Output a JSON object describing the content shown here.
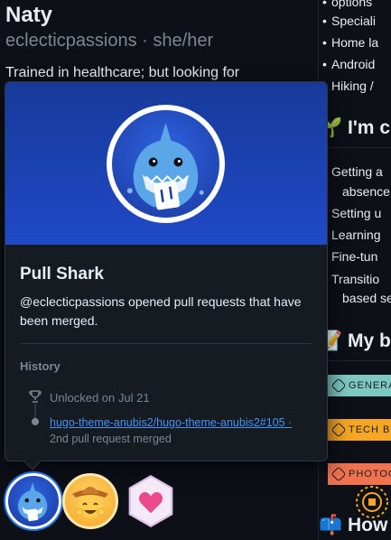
{
  "profile": {
    "name": "Naty",
    "handle": "eclecticpassions · she/her",
    "bio": "Trained in healthcare; but looking for"
  },
  "readme": {
    "bullets_top": [
      "options",
      "Speciali",
      "Home la",
      "Android",
      "Hiking /"
    ],
    "heading_curious": "🌱 I'm cu",
    "curious_bullets": [
      "Getting a",
      "absence",
      "Setting u",
      "Learning",
      "Fine-tun",
      "Transitio",
      "based se"
    ],
    "heading_blog": "📝 My bl",
    "badges": [
      {
        "label": "GENERAL",
        "color": "#7ec8c2"
      },
      {
        "label": "TECH BL",
        "color": "#f5a623"
      },
      {
        "label": "PHOTOGR",
        "color": "#f0724f"
      }
    ],
    "heading_how": "📫 How t"
  },
  "popover": {
    "title": "Pull Shark",
    "description": "@eclecticpassions opened pull requests that have been merged.",
    "history_label": "History",
    "unlocked_text": "Unlocked on Jul 21",
    "pr_link": "hugo-theme-anubis2/hugo-theme-anubis2#105",
    "pr_separator": " ·",
    "pr_subtext": "2nd pull request merged",
    "hero_color": "#1f49c7"
  },
  "achievements": [
    {
      "name": "Pull Shark",
      "icon": "shark-icon"
    },
    {
      "name": "YOLO",
      "icon": "cowboy-icon"
    },
    {
      "name": "Heart",
      "icon": "heart-icon"
    }
  ]
}
